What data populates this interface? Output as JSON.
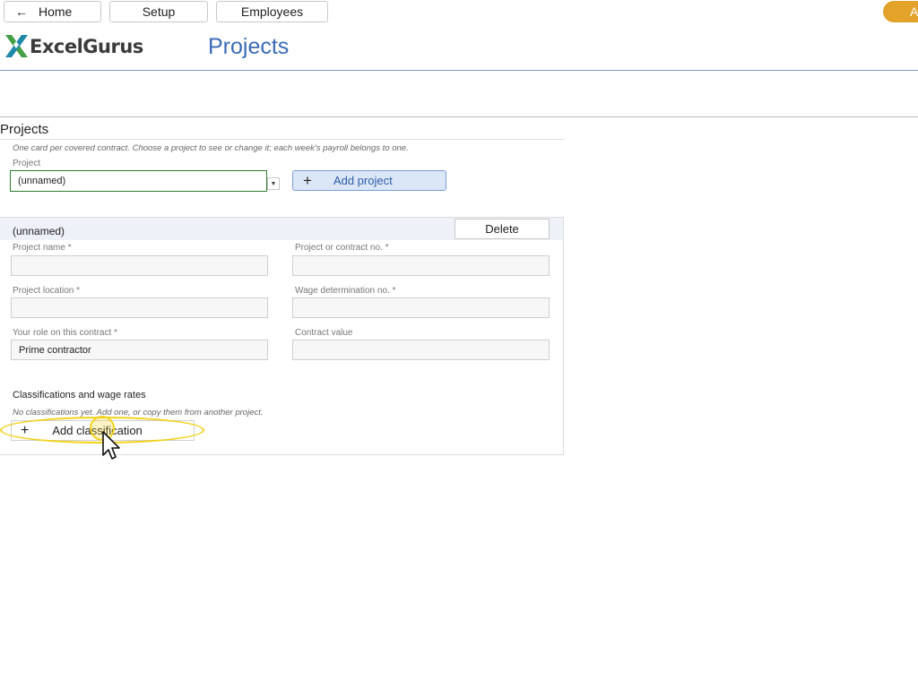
{
  "nav": {
    "home_label": "Home",
    "setup_label": "Setup",
    "employees_label": "Employees",
    "orange_tab_label": "A"
  },
  "brand": {
    "name": "ExcelGurus",
    "colors": {
      "green": "#43a047",
      "teal": "#1e88a8",
      "blue": "#3b6bb5",
      "orange": "#e3a32a"
    }
  },
  "page": {
    "heading": "Projects"
  },
  "projects_section": {
    "title": "Projects",
    "helper_text": "One card per covered contract. Choose a project to see or change it; each week's payroll belongs to one.",
    "project_label": "Project",
    "selected_project": "(unnamed)",
    "add_project_label": "Add project",
    "add_icon": "plus-icon"
  },
  "card": {
    "title": "(unnamed)",
    "delete_label": "Delete",
    "fields": {
      "project_name_label": "Project name *",
      "project_name_value": "",
      "contract_no_label": "Project or contract no. *",
      "contract_no_value": "",
      "location_label": "Project location *",
      "location_value": "",
      "wage_det_label": "Wage determination no. *",
      "wage_det_value": "",
      "role_label": "Your role on this contract *",
      "role_value": "Prime contractor",
      "contract_value_label": "Contract value",
      "contract_value_value": ""
    },
    "classifications": {
      "heading": "Classifications and wage rates",
      "empty_text": "No classifications yet. Add one, or copy them from another project.",
      "add_label": "Add classification"
    }
  }
}
